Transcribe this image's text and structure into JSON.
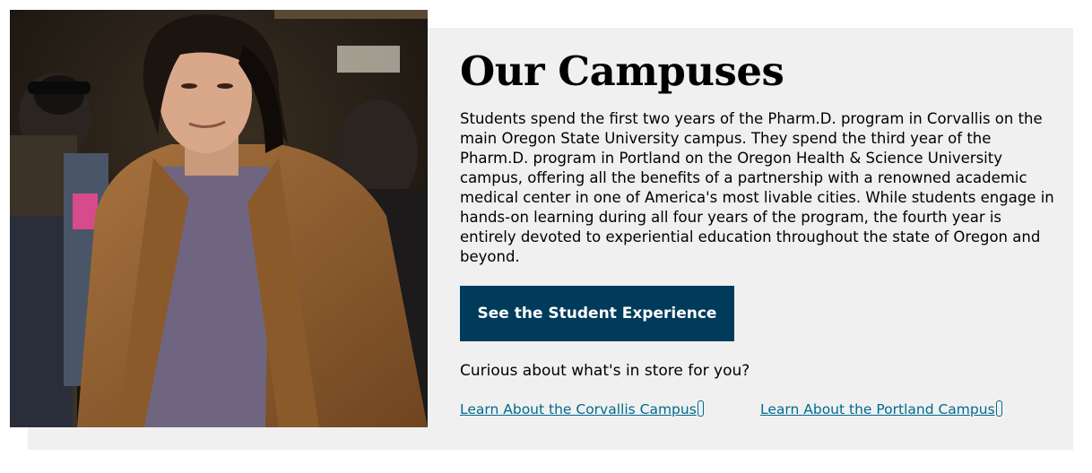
{
  "campuses": {
    "heading": "Our Campuses",
    "description": "Students spend the first two years of the Pharm.D. program in Corvallis on the main Oregon State University campus. They spend the third year of the Pharm.D. program in Portland on the Oregon Health & Science University campus, offering all the benefits of a partnership with a renowned academic medical center in one of America's most livable cities. While students engage in hands-on learning during all four years of the program, the fourth year is entirely devoted to experiential education throughout the state of Oregon and beyond.",
    "cta_label": "See the Student Experience",
    "curious_text": "Curious about what's in store for you?",
    "links": {
      "corvallis": "Learn About the Corvallis Campus",
      "portland": "Learn About the Portland Campus"
    }
  },
  "colors": {
    "panel": "#f0f0f0",
    "button": "#003b5c",
    "link": "#006a8e"
  }
}
